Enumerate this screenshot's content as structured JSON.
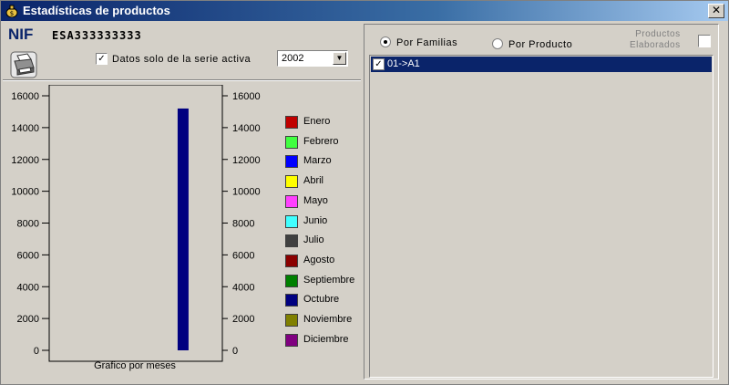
{
  "window": {
    "title": "Estadísticas de productos",
    "close_glyph": "✕"
  },
  "header": {
    "nif_label": "NIF",
    "nif_value": "ESA333333333",
    "active_series_checkbox": {
      "label": "Datos solo de la serie activa",
      "checked": true
    },
    "year_select": {
      "value": "2002"
    }
  },
  "chart_data": {
    "type": "bar",
    "xlabel": "Grafico por meses",
    "ylim": [
      0,
      16000
    ],
    "yticks": [
      0,
      2000,
      4000,
      6000,
      8000,
      10000,
      12000,
      14000,
      16000
    ],
    "ytick_labels": [
      "0",
      "2000",
      "4000",
      "6000",
      "8000",
      "10000",
      "12000",
      "14000",
      "16000"
    ],
    "categories": [
      "Enero",
      "Febrero",
      "Marzo",
      "Abril",
      "Mayo",
      "Junio",
      "Julio",
      "Agosto",
      "Septiembre",
      "Octubre",
      "Noviembre",
      "Diciembre"
    ],
    "colors": [
      "#c00000",
      "#40ff40",
      "#0000ff",
      "#ffff00",
      "#ff40ff",
      "#40ffff",
      "#404040",
      "#8b0000",
      "#008000",
      "#000080",
      "#808000",
      "#800080"
    ],
    "values": [
      0,
      0,
      0,
      0,
      0,
      0,
      0,
      0,
      0,
      15200,
      0,
      0
    ]
  },
  "filters": {
    "por_familias": {
      "label": "Por Familias",
      "selected": true
    },
    "por_producto": {
      "label": "Por Producto",
      "selected": false
    },
    "productos_elaborados": {
      "label_line1": "Productos",
      "label_line2": "Elaborados",
      "checked": false
    }
  },
  "list": {
    "items": [
      {
        "label": "01->A1",
        "checked": true,
        "selected": true
      }
    ]
  }
}
